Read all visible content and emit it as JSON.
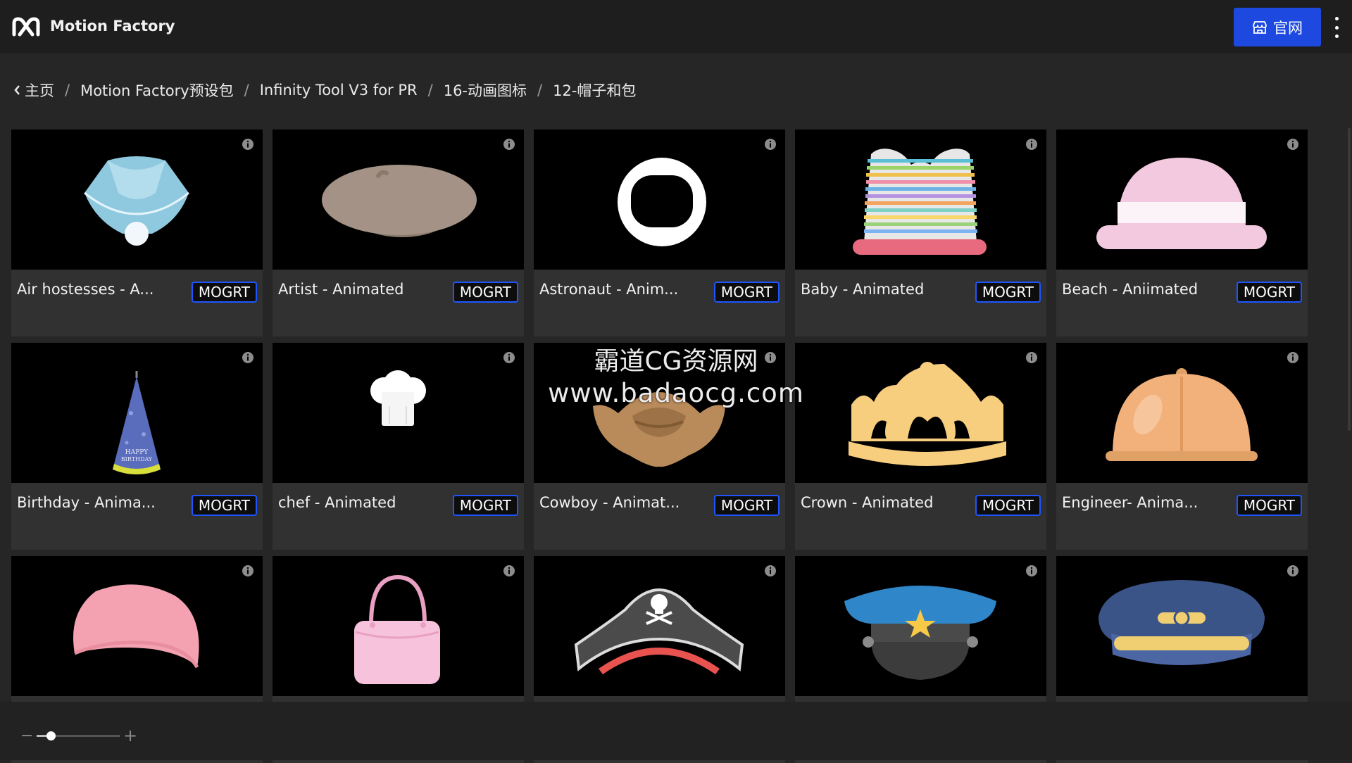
{
  "header": {
    "app_title": "Motion Factory",
    "site_button_label": "官网",
    "logo_icon": "motion-factory-logo-icon",
    "more_icon": "vertical-dots-icon"
  },
  "breadcrumb": {
    "items": [
      "主页",
      "Motion Factory预设包",
      "Infinity Tool V3 for PR",
      "16-动画图标",
      "12-帽子和包"
    ],
    "separator": "/"
  },
  "presets": [
    {
      "title": "Air hostesses - A...",
      "button": "MOGRT",
      "icon": "air-hostess-hat-icon"
    },
    {
      "title": "Artist - Animated",
      "button": "MOGRT",
      "icon": "beret-icon"
    },
    {
      "title": "Astronaut - Anim...",
      "button": "MOGRT",
      "icon": "astronaut-helmet-icon"
    },
    {
      "title": "Baby - Animated",
      "button": "MOGRT",
      "icon": "striped-baby-hat-icon"
    },
    {
      "title": "Beach - Aniimated",
      "button": "MOGRT",
      "icon": "beach-hat-icon"
    },
    {
      "title": "Birthday - Anima...",
      "button": "MOGRT",
      "icon": "party-hat-icon"
    },
    {
      "title": "chef - Animated",
      "button": "MOGRT",
      "icon": "chef-hat-icon"
    },
    {
      "title": "Cowboy - Animat...",
      "button": "MOGRT",
      "icon": "cowboy-hat-icon"
    },
    {
      "title": "Crown - Animated",
      "button": "MOGRT",
      "icon": "crown-icon"
    },
    {
      "title": "Engineer- Anima...",
      "button": "MOGRT",
      "icon": "hard-hat-icon"
    },
    {
      "title": "",
      "button": "",
      "icon": "pink-cap-icon"
    },
    {
      "title": "",
      "button": "",
      "icon": "handbag-icon"
    },
    {
      "title": "",
      "button": "",
      "icon": "pirate-hat-icon"
    },
    {
      "title": "",
      "button": "",
      "icon": "police-cap-icon"
    },
    {
      "title": "",
      "button": "",
      "icon": "pilot-cap-icon"
    }
  ],
  "watermark": {
    "line1": "霸道CG资源网",
    "line2": "www.badaocg.com"
  },
  "zoom": {
    "minus_label": "−",
    "plus_label": "+",
    "level": 0.18
  },
  "colors": {
    "accent": "#1d49e0",
    "mogrt_border": "#1f55ff"
  }
}
